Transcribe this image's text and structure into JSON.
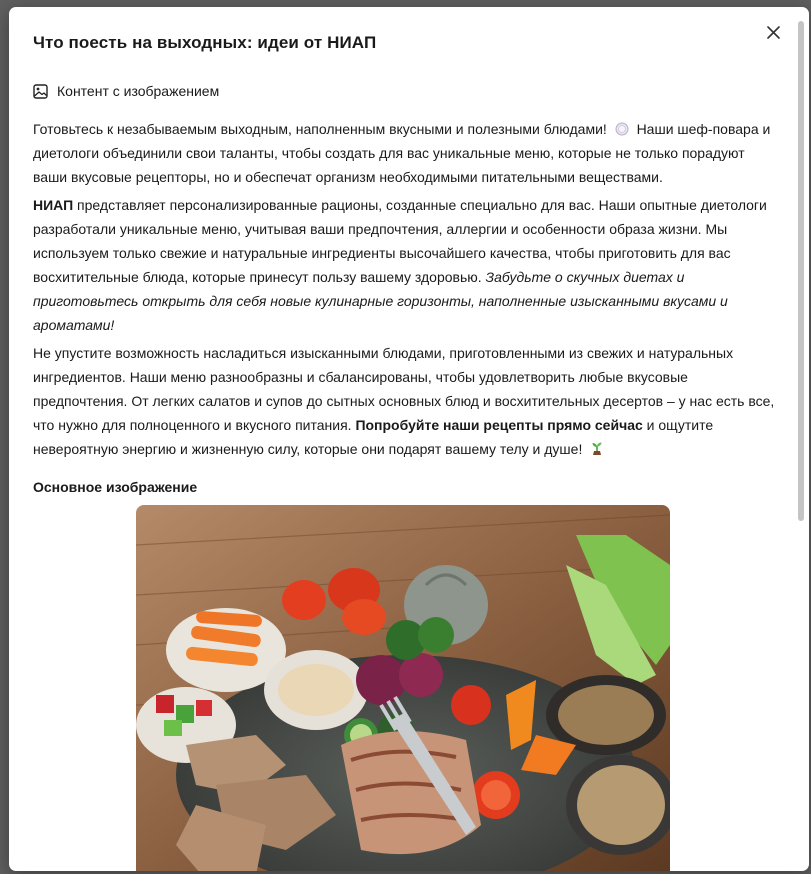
{
  "modal": {
    "title": "Что поесть на выходных: идеи от НИАП",
    "close_icon": "close-icon"
  },
  "content_kind": {
    "icon": "image-icon",
    "label": "Контент с изображением"
  },
  "article": {
    "p1": {
      "text_a": "Готовьтесь к незабываемым выходным, наполненным вкусными и полезными блюдами!",
      "emoji": "plate-emoji-icon",
      "text_b": "Наши шеф-повара и диетологи объединили свои таланты, чтобы создать для вас уникальные меню, которые не только порадуют ваши вкусовые рецепторы, но и обеспечат организм необходимыми питательными веществами."
    },
    "p2": {
      "brand": "НИАП",
      "text_a": " представляет персонализированные рационы, созданные специально для вас. Наши опытные диетологи разработали уникальные меню, учитывая ваши предпочтения, аллергии и особенности образа жизни. Мы используем только свежие и натуральные ингредиенты высочайшего качества, чтобы приготовить для вас восхитительные блюда, которые принесут пользу вашему здоровью. ",
      "italic": "Забудьте о скучных диетах и приготовьтесь открыть для себя новые кулинарные горизонты, наполненные изысканными вкусами и ароматами!"
    },
    "p3": {
      "text_a": "Не упустите возможность насладиться изысканными блюдами, приготовленными из свежих и натуральных ингредиентов. Наши меню разнообразны и сбалансированы, чтобы удовлетворить любые вкусовые предпочтения. От легких салатов и супов до сытных основных блюд и восхитительных десертов – у нас есть все, что нужно для полноценного и вкусного питания. ",
      "bold": "Попробуйте наши рецепты прямо сейчас",
      "text_b": " и ощутите невероятную энергию и жизненную силу, которые они подарят вашему телу и душе!",
      "emoji": "sprout-emoji-icon"
    }
  },
  "main_image": {
    "section_title": "Основное изображение",
    "depicts": "food-photo"
  },
  "colors": {
    "text": "#1a1a1a",
    "modal_bg": "#ffffff",
    "backdrop": "#5f5f5f",
    "scrollbar": "#c4c4c4"
  }
}
